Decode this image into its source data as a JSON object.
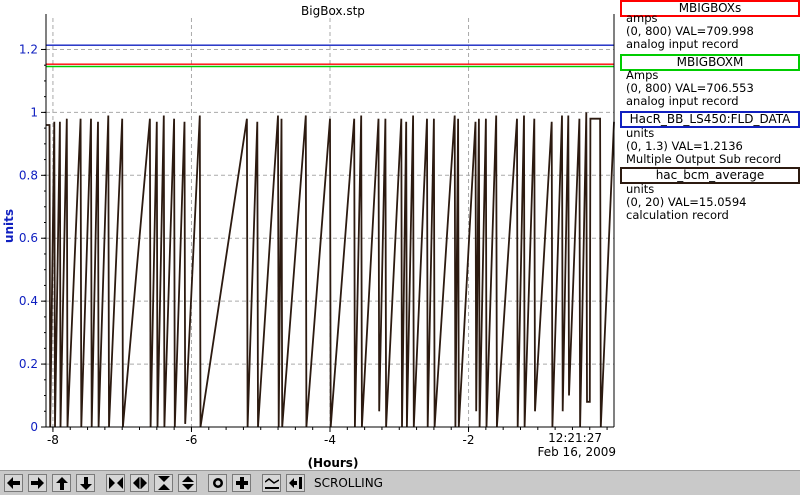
{
  "plot": {
    "title": "BigBox.stp",
    "y_axis_label": "units",
    "x_axis_label": "(Hours)",
    "time": "12:21:27",
    "date": "Feb 16, 2009"
  },
  "colors": {
    "blue": "#1020c0",
    "green": "#00cc00",
    "red": "#ff0000",
    "dark": "#2c1a10",
    "grid": "#aaaaaa"
  },
  "legend": [
    {
      "name": "MBIGBOXs",
      "color": "#ff0000",
      "units": "amps",
      "range": "(0, 800)  VAL=709.998",
      "type": "analog input record"
    },
    {
      "name": "MBIGBOXM",
      "color": "#00cc00",
      "units": "Amps",
      "range": "(0, 800)  VAL=706.553",
      "type": "analog input record"
    },
    {
      "name": "HacR_BB_LS450:FLD_DATA",
      "color": "#1020c0",
      "units": "units",
      "range": "(0, 1.3) VAL=1.2136",
      "type": "Multiple Output Sub record"
    },
    {
      "name": "hac_bcm_average",
      "color": "#2c1a10",
      "units": "units",
      "range": "(0, 20) VAL=15.0594",
      "type": "calculation record"
    }
  ],
  "toolbar": {
    "buttons": [
      "arrow-left-icon",
      "arrow-right-icon",
      "arrow-up-icon",
      "arrow-down-icon",
      "zoom-in-horizontal-icon",
      "zoom-out-horizontal-icon",
      "zoom-in-vertical-icon",
      "zoom-out-vertical-icon",
      "record-icon",
      "add-icon",
      "graph-icon",
      "export-icon"
    ],
    "status": "SCROLLING"
  },
  "chart_data": {
    "type": "line",
    "xlabel": "(Hours)",
    "ylabel": "units",
    "xlim": [
      -8.1,
      0.1
    ],
    "ylim": [
      0,
      1.3
    ],
    "x_ticks": [
      -8,
      -6,
      -4,
      -2
    ],
    "y_ticks": [
      0,
      0.2,
      0.4,
      0.6,
      0.8,
      1,
      1.2
    ],
    "grid": true,
    "series": [
      {
        "name": "HacR_BB_LS450:FLD_DATA",
        "color": "#1020c0",
        "x": [
          -8.1,
          0.1
        ],
        "y": [
          1.2136,
          1.2136
        ]
      },
      {
        "name": "MBIGBOXM",
        "color": "#00cc00",
        "x": [
          -8.1,
          0.1
        ],
        "y": [
          1.146,
          1.146
        ]
      },
      {
        "name": "MBIGBOXs",
        "color": "#ff0000",
        "x": [
          -8.1,
          0.1
        ],
        "y": [
          1.153,
          1.153
        ]
      },
      {
        "name": "hac_bcm_average",
        "color": "#2c1a10",
        "x": [
          -8.1,
          -8.05,
          -8.04,
          -7.98,
          -7.97,
          -7.9,
          -7.89,
          -7.8,
          -7.79,
          -7.6,
          -7.59,
          -7.45,
          -7.44,
          -7.35,
          -7.34,
          -7.2,
          -7.19,
          -7.0,
          -6.99,
          -6.6,
          -6.59,
          -6.5,
          -6.49,
          -6.4,
          -6.39,
          -6.25,
          -6.24,
          -6.1,
          -6.09,
          -5.88,
          -5.87,
          -5.2,
          -5.19,
          -5.05,
          -5.04,
          -4.75,
          -4.74,
          -4.7,
          -4.69,
          -4.35,
          -4.34,
          -4.0,
          -3.99,
          -3.65,
          -3.64,
          -3.55,
          -3.54,
          -3.3,
          -3.29,
          -3.2,
          -3.19,
          -2.97,
          -2.96,
          -2.9,
          -2.89,
          -2.8,
          -2.79,
          -2.6,
          -2.59,
          -2.5,
          -2.49,
          -2.2,
          -2.19,
          -2.15,
          -2.14,
          -1.9,
          -1.89,
          -1.85,
          -1.84,
          -1.75,
          -1.74,
          -1.6,
          -1.59,
          -1.3,
          -1.29,
          -1.2,
          -1.19,
          -1.05,
          -1.04,
          -0.8,
          -0.79,
          -0.65,
          -0.64,
          -0.56,
          -0.55,
          -0.4,
          -0.39,
          -0.3,
          -0.29,
          -0.25,
          -0.24,
          -0.1,
          -0.09,
          0.1
        ],
        "y": [
          0.96,
          0.96,
          0,
          0.97,
          0,
          0.97,
          0,
          0.98,
          0,
          0.98,
          0,
          0.98,
          0,
          0.97,
          0,
          0.99,
          0,
          0.98,
          0,
          0.98,
          0,
          0.97,
          0,
          0.99,
          0,
          0.98,
          0,
          0.97,
          0.01,
          0.99,
          0,
          0.98,
          0,
          0.97,
          0,
          0.99,
          0,
          0.98,
          0,
          0.99,
          0,
          0.98,
          0,
          0.98,
          0,
          0.99,
          0,
          0.98,
          0.05,
          0.98,
          0,
          0.98,
          0,
          0.97,
          0,
          0.99,
          0,
          0.98,
          0,
          0.98,
          0,
          0.99,
          0,
          0.98,
          0,
          0.97,
          0.05,
          0.98,
          0,
          0.98,
          0,
          0.99,
          0,
          0.98,
          0,
          0.99,
          0,
          0.98,
          0.05,
          0.97,
          0,
          0.99,
          0.05,
          0.99,
          0.1,
          0.98,
          0,
          1.0,
          0.08,
          0.08,
          0.98,
          0.98,
          0,
          0.97
        ]
      }
    ]
  }
}
